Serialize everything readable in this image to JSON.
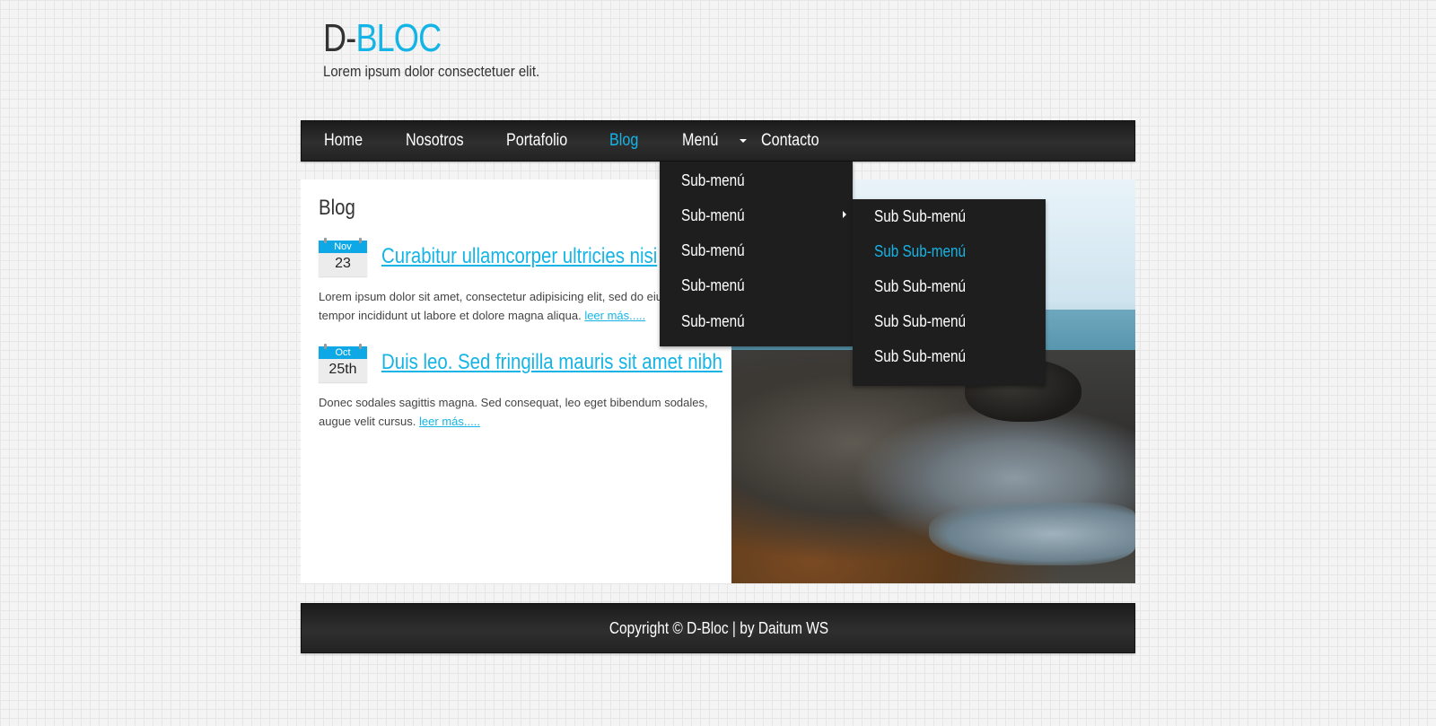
{
  "header": {
    "logo_prefix": "D-",
    "logo_accent": "BLOC",
    "tagline": "Lorem ipsum dolor consectetuer elit."
  },
  "nav": {
    "items": [
      {
        "label": "Home"
      },
      {
        "label": "Nosotros"
      },
      {
        "label": "Portafolio"
      },
      {
        "label": "Blog",
        "active": true
      },
      {
        "label": "Menú",
        "has_dropdown": true
      },
      {
        "label": "Contacto"
      }
    ]
  },
  "dropdown": {
    "items": [
      "Sub-menú",
      "Sub-menú",
      "Sub-menú",
      "Sub-menú",
      "Sub-menú"
    ]
  },
  "subdropdown": {
    "items": [
      "Sub Sub-menú",
      "Sub Sub-menú",
      "Sub Sub-menú",
      "Sub Sub-menú",
      "Sub Sub-menú"
    ],
    "active_index": 1
  },
  "main": {
    "title": "Blog",
    "posts": [
      {
        "month": "Nov",
        "day": "23",
        "title": "Curabitur ullamcorper ultricies nisi",
        "text": "Lorem ipsum dolor sit amet, consectetur adipisicing elit, sed do eiusmod tempor incididunt ut labore et dolore magna aliqua.",
        "more": "leer más....."
      },
      {
        "month": "Oct",
        "day": "25th",
        "title": "Duis leo. Sed fringilla mauris sit amet nibh",
        "text": "Donec sodales sagittis magna. Sed consequat, leo eget bibendum sodales, augue velit cursus.",
        "more": "leer más....."
      }
    ]
  },
  "footer": {
    "text": "Copyright © D-Bloc | by Daitum WS"
  },
  "colors": {
    "accent": "#15b4e6",
    "bar": "#2a2a2a",
    "dropdown": "#1e1e1e"
  }
}
